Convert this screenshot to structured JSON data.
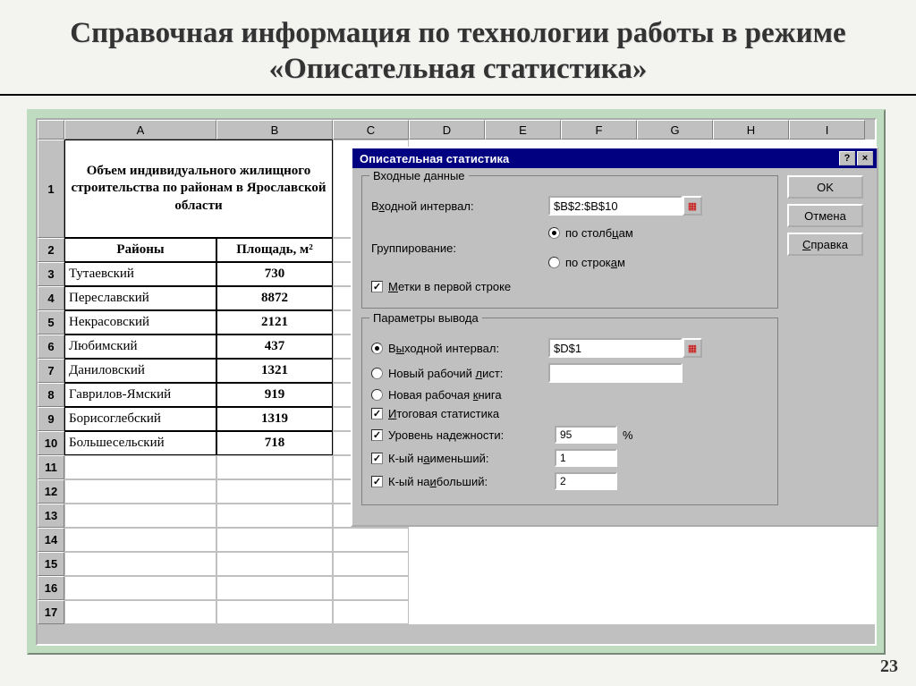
{
  "title": "Справочная информация по технологии работы в режиме «Описательная статистика»",
  "page_number": "23",
  "columns": [
    "A",
    "B",
    "C",
    "D",
    "E",
    "F",
    "G",
    "H",
    "I"
  ],
  "rows": [
    "1",
    "2",
    "3",
    "4",
    "5",
    "6",
    "7",
    "8",
    "9",
    "10",
    "11",
    "12",
    "13",
    "14",
    "15",
    "16",
    "17"
  ],
  "table_title": "Объем индивидуального жилищного строительства по районам в Ярославской области",
  "headers": {
    "col1": "Районы",
    "col2": "Площадь, м²"
  },
  "data_rows": [
    {
      "name": "Тутаевский",
      "val": "730"
    },
    {
      "name": "Переславский",
      "val": "8872"
    },
    {
      "name": "Некрасовский",
      "val": "2121"
    },
    {
      "name": "Любимский",
      "val": "437"
    },
    {
      "name": "Даниловский",
      "val": "1321"
    },
    {
      "name": "Гаврилов-Ямский",
      "val": "919"
    },
    {
      "name": "Борисоглебский",
      "val": "1319"
    },
    {
      "name": "Большесельский",
      "val": "718"
    }
  ],
  "dialog": {
    "title": "Описательная статистика",
    "buttons": {
      "ok": "OK",
      "cancel": "Отмена",
      "help": "Справка"
    },
    "group_input": "Входные данные",
    "input_range_label": "Входной интервал:",
    "input_range_value": "$B$2:$B$10",
    "grouping_label": "Группирование:",
    "grouping_cols": "по столбцам",
    "grouping_rows": "по строкам",
    "labels_first_row": "Метки в первой строке",
    "group_output": "Параметры вывода",
    "output_range_label": "Выходной интервал:",
    "output_range_value": "$D$1",
    "new_sheet_label": "Новый рабочий лист:",
    "new_book_label": "Новая рабочая книга",
    "summary_stats_label": "Итоговая статистика",
    "confidence_label": "Уровень надежности:",
    "confidence_value": "95",
    "kth_smallest_label": "К-ый наименьший:",
    "kth_smallest_value": "1",
    "kth_largest_label": "К-ый наибольший:",
    "kth_largest_value": "2"
  }
}
